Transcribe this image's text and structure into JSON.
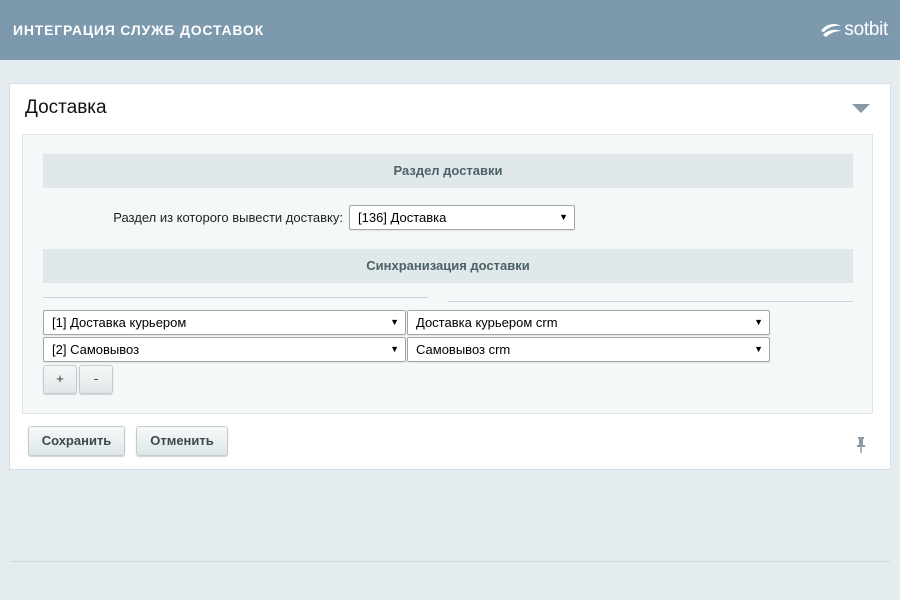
{
  "header": {
    "title": "ИНТЕГРАЦИЯ СЛУЖБ ДОСТАВОК",
    "logo_text": "sotbit",
    "logo_icon": "sotbit-logo-icon"
  },
  "panel": {
    "title": "Доставка",
    "collapse_icon": "triangle-down-icon"
  },
  "section_delivery": {
    "heading": "Раздел доставки",
    "field_label": "Раздел из которого вывести доставку:",
    "field_value": "[136] Доставка"
  },
  "section_sync": {
    "heading": "Синхранизация доставки",
    "rows": [
      {
        "left": "[1] Доставка курьером",
        "right": "Доставка курьером crm"
      },
      {
        "left": "[2] Самовывоз",
        "right": "Самовывоз crm"
      }
    ],
    "add_label": "+",
    "remove_label": "-"
  },
  "footer": {
    "save_label": "Сохранить",
    "cancel_label": "Отменить",
    "pin_icon": "pin-icon"
  },
  "colors": {
    "topbar": "#7c99ae",
    "background": "#e4ecef",
    "section_header": "#e0e8ea"
  }
}
